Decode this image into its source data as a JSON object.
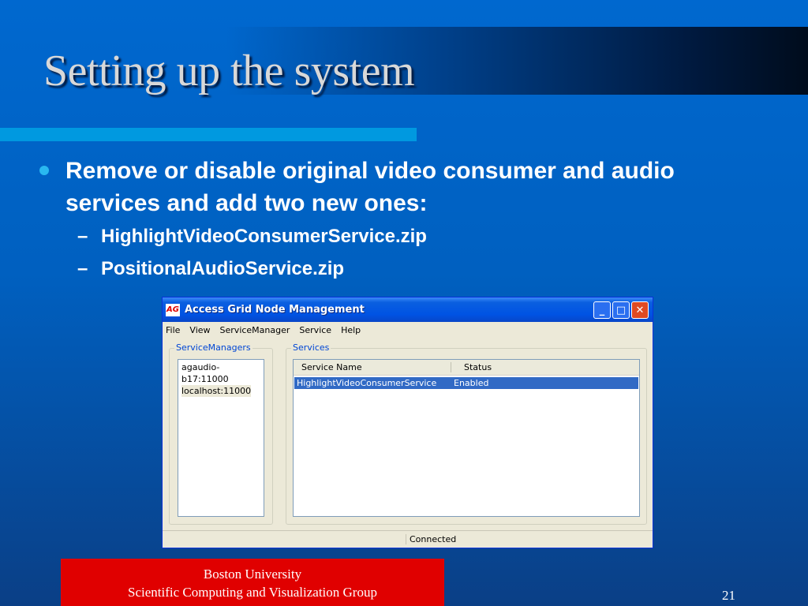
{
  "slide": {
    "title": "Setting up the system",
    "bullet": "Remove or disable original video consumer and audio services and add two new ones:",
    "subitems": [
      "HighlightVideoConsumerService.zip",
      "PositionalAudioService.zip"
    ],
    "footer_line1": "Boston University",
    "footer_line2": "Scientific Computing and Visualization Group",
    "page_number": "21"
  },
  "window": {
    "icon": "AG",
    "title": "Access Grid Node Management",
    "menu": [
      "File",
      "View",
      "ServiceManager",
      "Service",
      "Help"
    ],
    "service_managers_label": "ServiceManagers",
    "service_managers": [
      "agaudio-b17:11000",
      "localhost:11000"
    ],
    "services_label": "Services",
    "columns": [
      "Service Name",
      "Status"
    ],
    "rows": [
      {
        "name": "HighlightVideoConsumerService",
        "status": "Enabled"
      }
    ],
    "status": "Connected"
  }
}
